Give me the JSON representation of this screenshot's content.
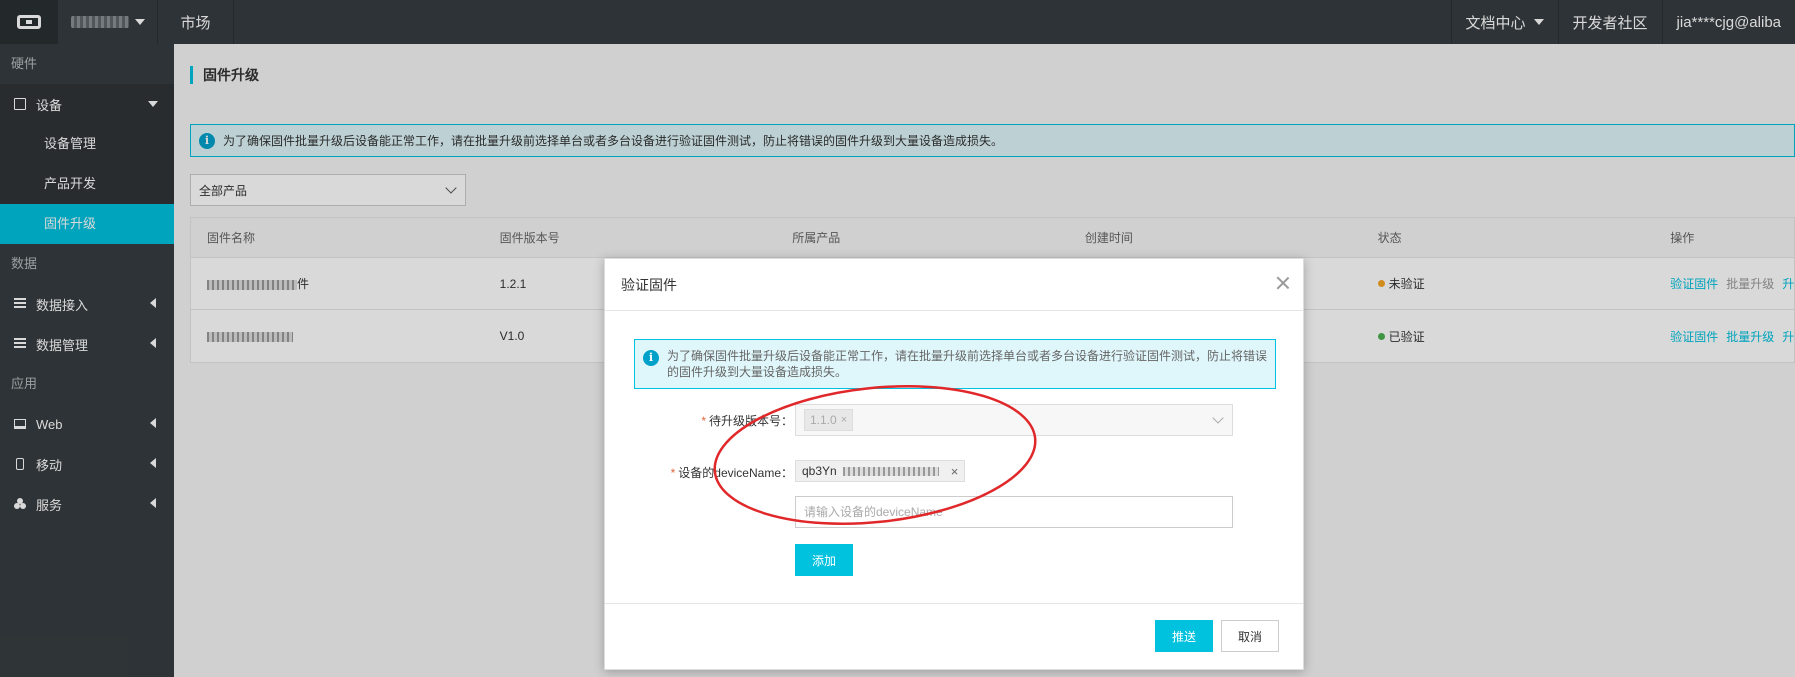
{
  "topbar": {
    "market": "市场",
    "docs": "文档中心",
    "community": "开发者社区",
    "user": "jia****cjg@aliba"
  },
  "sidebar": {
    "section_hardware": "硬件",
    "device_group": "设备",
    "sub_items": [
      "设备管理",
      "产品开发",
      "固件升级"
    ],
    "section_data": "数据",
    "data_access": "数据接入",
    "data_manage": "数据管理",
    "section_app": "应用",
    "web": "Web",
    "mobile": "移动",
    "service": "服务"
  },
  "main": {
    "title": "固件升级",
    "info": "为了确保固件批量升级后设备能正常工作，请在批量升级前选择单台或者多台设备进行验证固件测试，防止将错误的固件升级到大量设备造成损失。",
    "product_select": "全部产品",
    "table": {
      "headers": [
        "固件名称",
        "固件版本号",
        "所属产品",
        "创建时间",
        "状态",
        "操作"
      ],
      "rows": [
        {
          "name_suffix": "件",
          "version": "1.2.1",
          "status": "未验证",
          "status_color": "#f5a623",
          "op1": "验证固件",
          "op2": "批量升级",
          "op3": "升"
        },
        {
          "name_suffix": "",
          "version": "V1.0",
          "status": "已验证",
          "status_color": "#4caf50",
          "op1": "验证固件",
          "op2": "批量升级",
          "op3": "升"
        }
      ]
    }
  },
  "modal": {
    "title": "验证固件",
    "info": "为了确保固件批量升级后设备能正常工作，请在批量升级前选择单台或者多台设备进行验证固件测试，防止将错误的固件升级到大量设备造成损失。",
    "version_label": "待升级版本号：",
    "version_tag": "1.1.0",
    "device_label": "设备的deviceName：",
    "device_tag": "qb3Yn",
    "device_placeholder": "请输入设备的deviceName",
    "add_label": "添加",
    "push_label": "推送",
    "cancel_label": "取消"
  },
  "colors": {
    "accent": "#00c1de",
    "sidebar_bg": "#373d41",
    "annotation": "#e0282b"
  }
}
